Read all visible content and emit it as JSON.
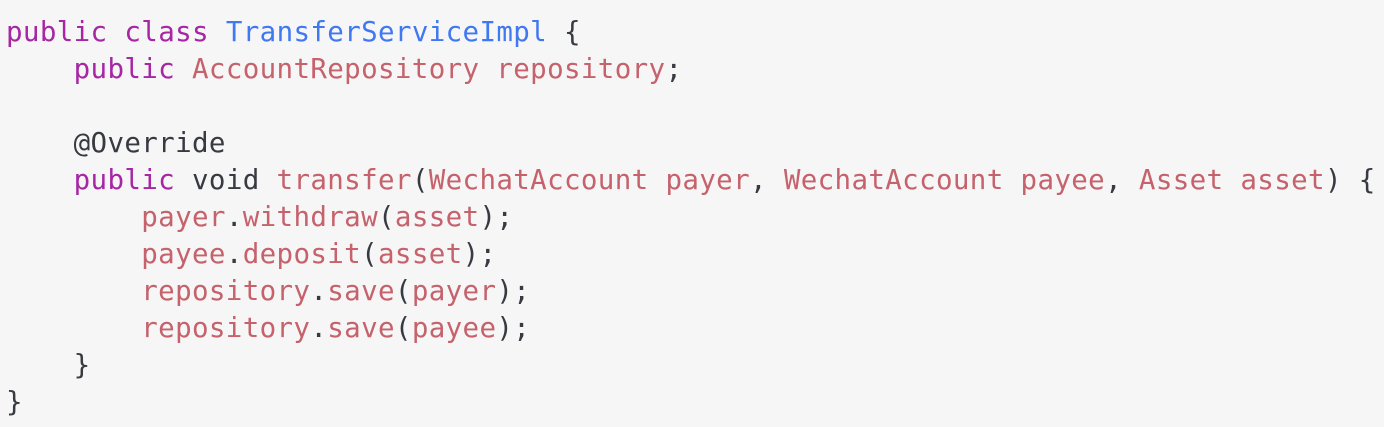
{
  "code": {
    "language": "java",
    "lines": [
      [
        {
          "text": "public",
          "role": "kw"
        },
        {
          "text": " ",
          "role": "punc"
        },
        {
          "text": "class",
          "role": "kw"
        },
        {
          "text": " ",
          "role": "punc"
        },
        {
          "text": "TransferServiceImpl",
          "role": "cls"
        },
        {
          "text": " {",
          "role": "punc"
        }
      ],
      [
        {
          "text": "    ",
          "role": "punc"
        },
        {
          "text": "public",
          "role": "kw"
        },
        {
          "text": " ",
          "role": "punc"
        },
        {
          "text": "AccountRepository",
          "role": "ident"
        },
        {
          "text": " ",
          "role": "punc"
        },
        {
          "text": "repository",
          "role": "ident"
        },
        {
          "text": ";",
          "role": "punc"
        }
      ],
      [],
      [
        {
          "text": "    ",
          "role": "punc"
        },
        {
          "text": "@Override",
          "role": "ann"
        }
      ],
      [
        {
          "text": "    ",
          "role": "punc"
        },
        {
          "text": "public",
          "role": "kw"
        },
        {
          "text": " void ",
          "role": "punc"
        },
        {
          "text": "transfer",
          "role": "ident"
        },
        {
          "text": "(",
          "role": "punc"
        },
        {
          "text": "WechatAccount",
          "role": "ident"
        },
        {
          "text": " ",
          "role": "punc"
        },
        {
          "text": "payer",
          "role": "ident"
        },
        {
          "text": ", ",
          "role": "punc"
        },
        {
          "text": "WechatAccount",
          "role": "ident"
        },
        {
          "text": " ",
          "role": "punc"
        },
        {
          "text": "payee",
          "role": "ident"
        },
        {
          "text": ", ",
          "role": "punc"
        },
        {
          "text": "Asset",
          "role": "ident"
        },
        {
          "text": " ",
          "role": "punc"
        },
        {
          "text": "asset",
          "role": "ident"
        },
        {
          "text": ") {",
          "role": "punc"
        }
      ],
      [
        {
          "text": "        ",
          "role": "punc"
        },
        {
          "text": "payer",
          "role": "ident"
        },
        {
          "text": ".",
          "role": "punc"
        },
        {
          "text": "withdraw",
          "role": "ident"
        },
        {
          "text": "(",
          "role": "punc"
        },
        {
          "text": "asset",
          "role": "ident"
        },
        {
          "text": ");",
          "role": "punc"
        }
      ],
      [
        {
          "text": "        ",
          "role": "punc"
        },
        {
          "text": "payee",
          "role": "ident"
        },
        {
          "text": ".",
          "role": "punc"
        },
        {
          "text": "deposit",
          "role": "ident"
        },
        {
          "text": "(",
          "role": "punc"
        },
        {
          "text": "asset",
          "role": "ident"
        },
        {
          "text": ");",
          "role": "punc"
        }
      ],
      [
        {
          "text": "        ",
          "role": "punc"
        },
        {
          "text": "repository",
          "role": "ident"
        },
        {
          "text": ".",
          "role": "punc"
        },
        {
          "text": "save",
          "role": "ident"
        },
        {
          "text": "(",
          "role": "punc"
        },
        {
          "text": "payer",
          "role": "ident"
        },
        {
          "text": ");",
          "role": "punc"
        }
      ],
      [
        {
          "text": "        ",
          "role": "punc"
        },
        {
          "text": "repository",
          "role": "ident"
        },
        {
          "text": ".",
          "role": "punc"
        },
        {
          "text": "save",
          "role": "ident"
        },
        {
          "text": "(",
          "role": "punc"
        },
        {
          "text": "payee",
          "role": "ident"
        },
        {
          "text": ");",
          "role": "punc"
        }
      ],
      [
        {
          "text": "    }",
          "role": "punc"
        }
      ],
      [
        {
          "text": "}",
          "role": "punc"
        }
      ]
    ]
  },
  "colors": {
    "background": "#f6f6f6",
    "keyword": "#a626a4",
    "class_name": "#4078f2",
    "identifier": "#c5626c",
    "plain": "#383a42"
  }
}
